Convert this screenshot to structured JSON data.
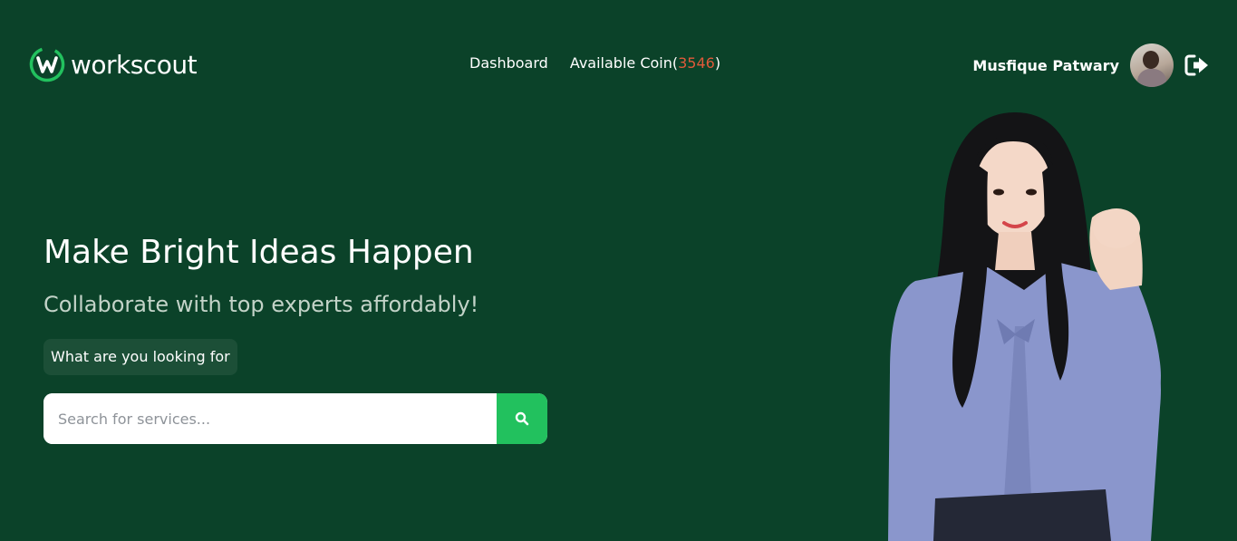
{
  "brand": {
    "name": "workscout",
    "logo_icon": "w-circle-logo",
    "accent": "#22c15e"
  },
  "nav": {
    "dashboard_label": "Dashboard",
    "coin_label": "Available Coin(",
    "coin_value": "3546",
    "coin_close": ")",
    "coin_color": "#e05a3a"
  },
  "user": {
    "name": "Musfique Patwary",
    "avatar_icon": "user-avatar",
    "logout_icon": "sign-out-icon"
  },
  "hero": {
    "title": "Make Bright Ideas Happen",
    "subtitle": "Collaborate with top experts affordably!",
    "prompt": "What are you looking for",
    "search_placeholder": "Search for services...",
    "search_icon": "search-icon",
    "image": "woman-in-blue-blouse-raising-fist"
  },
  "colors": {
    "background": "#0b4229",
    "search_button": "#22c15e"
  }
}
